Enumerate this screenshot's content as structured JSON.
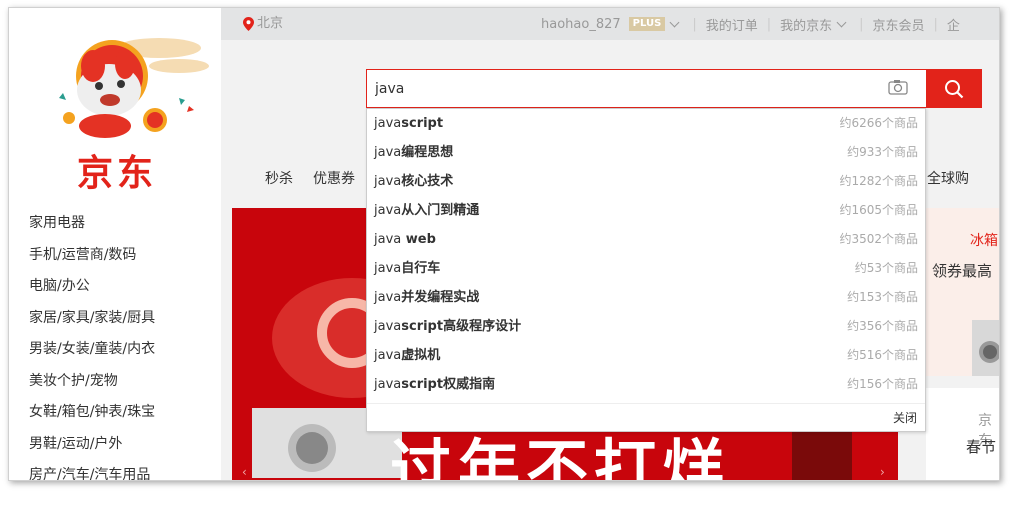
{
  "topbar": {
    "location": "北京",
    "username": "haohao_827",
    "plus_badge": "PLUS",
    "my_orders": "我的订单",
    "my_jd": "我的京东",
    "jd_member": "京东会员",
    "enterprise": "企"
  },
  "logo": {
    "text": "京东"
  },
  "search": {
    "value": "java"
  },
  "suggestions": [
    {
      "prefix": "java",
      "rest": "script",
      "count": "约6266个商品"
    },
    {
      "prefix": "java",
      "rest": "编程思想",
      "count": "约933个商品"
    },
    {
      "prefix": "java",
      "rest": "核心技术",
      "count": "约1282个商品"
    },
    {
      "prefix": "java",
      "rest": "从入门到精通",
      "count": "约1605个商品"
    },
    {
      "prefix": "java",
      "rest": " web",
      "count": "约3502个商品"
    },
    {
      "prefix": "java",
      "rest": "自行车",
      "count": "约53个商品"
    },
    {
      "prefix": "java",
      "rest": "并发编程实战",
      "count": "约153个商品"
    },
    {
      "prefix": "java",
      "rest": "script高级程序设计",
      "count": "约356个商品"
    },
    {
      "prefix": "java",
      "rest": "虚拟机",
      "count": "约516个商品"
    },
    {
      "prefix": "java",
      "rest": "script权威指南",
      "count": "约156个商品"
    }
  ],
  "dropdown_close": "关闭",
  "nav": {
    "items": [
      "秒杀",
      "优惠券"
    ],
    "global": "全球购"
  },
  "categories": [
    "家用电器",
    "手机/运营商/数码",
    "电脑/办公",
    "家居/家具/家装/厨具",
    "男装/女装/童装/内衣",
    "美妆个护/宠物",
    "女鞋/箱包/钟表/珠宝",
    "男鞋/运动/户外",
    "房产/汽车/汽车用品"
  ],
  "banner": {
    "headline": "过年不打烊"
  },
  "side_promo": {
    "tag1": "冰箱",
    "text1": "领券最高",
    "tag2": "京东",
    "text2": "春节"
  },
  "colors": {
    "brand_red": "#e2231a",
    "banner_red": "#c8050c"
  }
}
